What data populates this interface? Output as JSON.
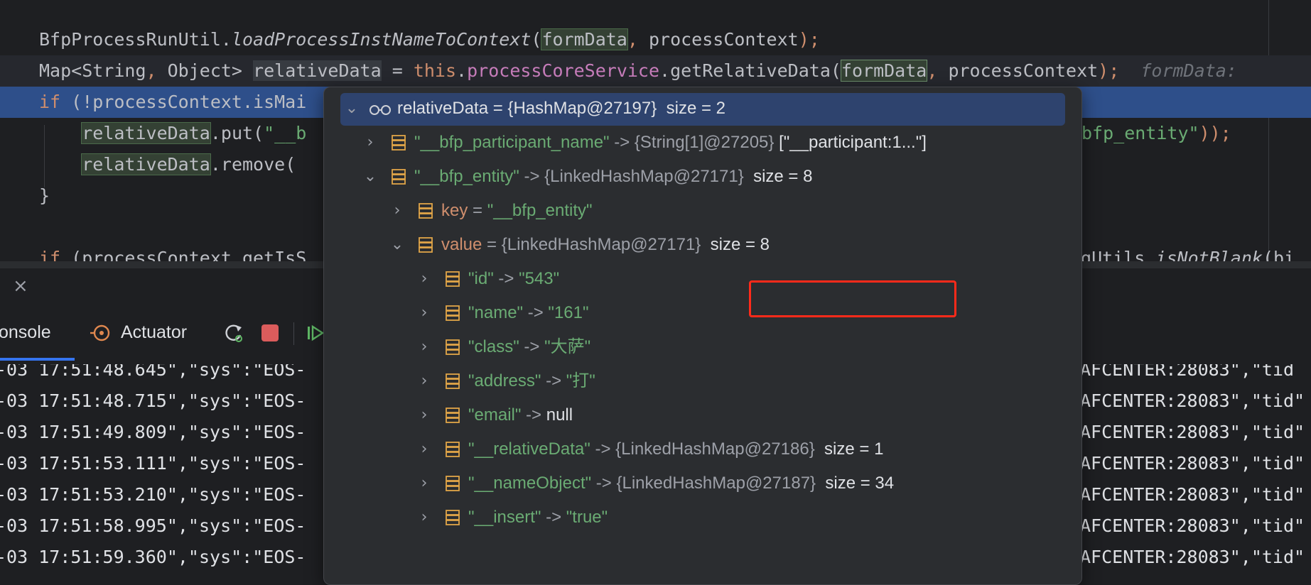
{
  "editor": {
    "lines": [
      {
        "parts": [
          {
            "t": "BfpProcessRunUtil.",
            "c": "c-ident"
          },
          {
            "t": "loadProcessInstNameToContext",
            "c": "c-ident c-italic"
          },
          {
            "t": "(",
            "c": "c-ident"
          },
          {
            "t": "formData",
            "c": "c-ident c-hl"
          },
          {
            "t": ", ",
            "c": "c-punct"
          },
          {
            "t": "processContext",
            "c": "c-ident"
          },
          {
            "t": ");",
            "c": "c-punct"
          }
        ]
      },
      {
        "parts": [
          {
            "t": "Map<String",
            "c": "c-ident"
          },
          {
            "t": ", ",
            "c": "c-punct"
          },
          {
            "t": "Object> ",
            "c": "c-ident"
          },
          {
            "t": "relativeData",
            "c": "c-ident c-hl3"
          },
          {
            "t": " = ",
            "c": "c-ident"
          },
          {
            "t": "this",
            "c": "c-key"
          },
          {
            "t": ".",
            "c": "c-ident"
          },
          {
            "t": "processCoreService",
            "c": "c-field"
          },
          {
            "t": ".getRelativeData(",
            "c": "c-ident"
          },
          {
            "t": "formData",
            "c": "c-ident c-hl2"
          },
          {
            "t": ", ",
            "c": "c-punct"
          },
          {
            "t": "processContext",
            "c": "c-ident"
          },
          {
            "t": ");",
            "c": "c-punct"
          },
          {
            "t": "  formData:",
            "c": "c-hint"
          }
        ]
      },
      {
        "parts": [
          {
            "t": "if",
            "c": "c-key"
          },
          {
            "t": " (!processContext.isMai",
            "c": "c-ident"
          }
        ]
      },
      {
        "parts": [
          {
            "t": "    ",
            "c": "c-ident"
          },
          {
            "t": "relativeData",
            "c": "c-ident c-hl"
          },
          {
            "t": ".put(",
            "c": "c-ident"
          },
          {
            "t": "\"__b",
            "c": "c-str"
          }
        ]
      },
      {
        "parts": [
          {
            "t": "    ",
            "c": "c-ident"
          },
          {
            "t": "relativeData",
            "c": "c-ident c-hl"
          },
          {
            "t": ".remove(",
            "c": "c-ident"
          }
        ]
      },
      {
        "parts": [
          {
            "t": "}",
            "c": "c-ident"
          }
        ]
      },
      {
        "parts": []
      },
      {
        "parts": [
          {
            "t": "if",
            "c": "c-key"
          },
          {
            "t": " (processContext.getIsS",
            "c": "c-ident"
          }
        ]
      }
    ],
    "right_fragments": [
      {
        "parts": [
          {
            "t": "bfp_entity\"",
            "c": "c-str"
          },
          {
            "t": "));",
            "c": "c-punct"
          }
        ]
      },
      {
        "parts": [
          {
            "t": "ngUtils.",
            "c": "c-ident"
          },
          {
            "t": "isNotBlank",
            "c": "c-ident c-italic"
          },
          {
            "t": "(bi",
            "c": "c-ident"
          }
        ]
      }
    ]
  },
  "tool_window": {
    "close_glyph": "×",
    "tabs": {
      "console": "onsole",
      "actuator": "Actuator"
    },
    "log_lines": [
      {
        "left": "-03 17:51:48.645\",\"sys\":\"EOS-",
        "right": "AFCENTER:28083\",\"tid"
      },
      {
        "left": "-03 17:51:48.715\",\"sys\":\"EOS-",
        "right": "AFCENTER:28083\",\"tid\""
      },
      {
        "left": "-03 17:51:49.809\",\"sys\":\"EOS-",
        "right": "AFCENTER:28083\",\"tid\""
      },
      {
        "left": "-03 17:51:53.111\",\"sys\":\"EOS-",
        "right": "AFCENTER:28083\",\"tid\""
      },
      {
        "left": "-03 17:51:53.210\",\"sys\":\"EOS-",
        "right": "AFCENTER:28083\",\"tid\""
      },
      {
        "left": "-03 17:51:58.995\",\"sys\":\"EOS-",
        "right": "AFCENTER:28083\",\"tid\""
      },
      {
        "left": "-03 17:51:59.360\",\"sys\":\"EOS-",
        "right": "AFCENTER:28083\",\"tid\""
      }
    ]
  },
  "debug_popup": {
    "root": {
      "name": "relativeData",
      "eq": " = ",
      "type": "{HashMap@27197}",
      "size": "size = 2"
    },
    "rows": [
      {
        "key": "\"__bfp_participant_name\"",
        "arrow": " -> ",
        "type": "{String[1]@27205}",
        "val": " [\"__participant:1...\"]",
        "expanded": false
      },
      {
        "key": "\"__bfp_entity\"",
        "arrow": " -> ",
        "type": "{LinkedHashMap@27171}",
        "val": "  size = 8",
        "expanded": true
      },
      {
        "key": "key",
        "arrow": " = ",
        "type": "",
        "val": "\"__bfp_entity\"",
        "expanded": false
      },
      {
        "key": "value",
        "arrow": " = ",
        "type": "{LinkedHashMap@27171}",
        "val": "  size = 8",
        "expanded": true
      },
      {
        "key": "\"id\"",
        "arrow": " -> ",
        "type": "",
        "val": "\"543\"",
        "expanded": false
      },
      {
        "key": "\"name\"",
        "arrow": " -> ",
        "type": "",
        "val": "\"161\"",
        "expanded": false
      },
      {
        "key": "\"class\"",
        "arrow": " -> ",
        "type": "",
        "val": "\"大萨\"",
        "expanded": false
      },
      {
        "key": "\"address\"",
        "arrow": " -> ",
        "type": "",
        "val": "\"打\"",
        "expanded": false
      },
      {
        "key": "\"email\"",
        "arrow": " -> ",
        "type": "",
        "val": "null",
        "expanded": false
      },
      {
        "key": "\"__relativeData\"",
        "arrow": " -> ",
        "type": "{LinkedHashMap@27186}",
        "val": "  size = 1",
        "expanded": false
      },
      {
        "key": "\"__nameObject\"",
        "arrow": " -> ",
        "type": "{LinkedHashMap@27187}",
        "val": "  size = 34",
        "expanded": false
      },
      {
        "key": "\"__insert\"",
        "arrow": " -> ",
        "type": "",
        "val": "\"true\"",
        "expanded": false
      }
    ],
    "chevrons": {
      "collapsed": "›",
      "expanded": "⌄"
    },
    "colors": {
      "highlight_box": "#ff2a1a",
      "root_bg": "#2e436e",
      "key_green": "#6aab73",
      "key_orange": "#cf8e6d"
    }
  }
}
